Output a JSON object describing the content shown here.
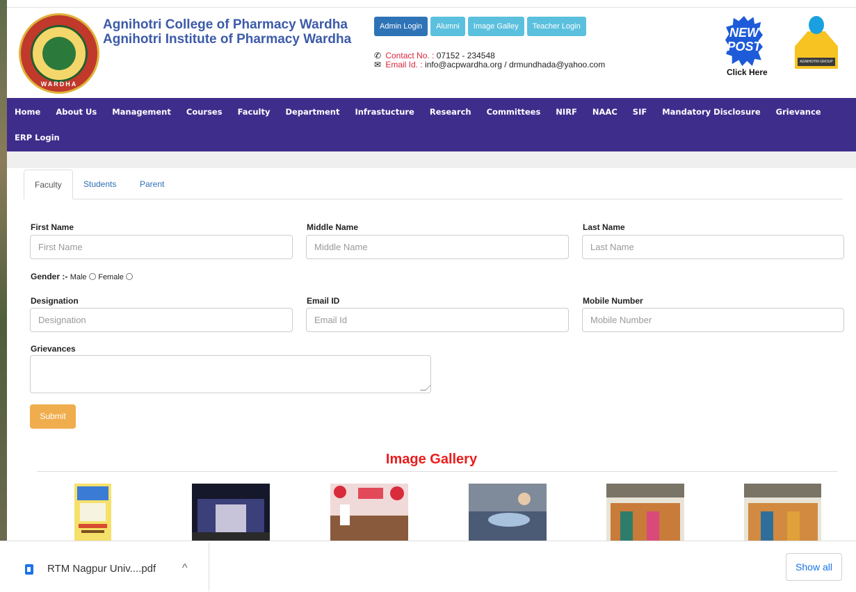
{
  "header": {
    "college_line1": "Agnihotri College of Pharmacy Wardha",
    "college_line2": "Agnihotri Institute of Pharmacy Wardha",
    "logo_text": "WARDHA",
    "top_buttons": [
      "Admin Login",
      "Alumni",
      "Image Galley",
      "Teacher Login"
    ],
    "contact_label": "Contact No. :",
    "contact_value": "07152 - 234548",
    "email_label": "Email Id. :",
    "email_value": "info@acpwardha.org / drmundhada@yahoo.com",
    "new_post_line1": "NEW",
    "new_post_line2": "POST",
    "new_post_click": "Click Here",
    "group_logo_text": "AGNIHOTRI GROUP"
  },
  "nav": {
    "row1": [
      "Home",
      "About Us",
      "Management",
      "Courses",
      "Faculty",
      "Department",
      "Infrastucture",
      "Research",
      "Committees",
      "NIRF",
      "NAAC",
      "SIF",
      "Mandatory Disclosure",
      "Grievance"
    ],
    "row2": [
      "ERP Login"
    ]
  },
  "tabs": [
    "Faculty",
    "Students",
    "Parent"
  ],
  "form": {
    "first_name_label": "First Name",
    "first_name_placeholder": "First Name",
    "middle_name_label": "Middle Name",
    "middle_name_placeholder": "Middle Name",
    "last_name_label": "Last Name",
    "last_name_placeholder": "Last Name",
    "gender_label": "Gender :-",
    "gender_male": "Male",
    "gender_female": "Female",
    "designation_label": "Designation",
    "designation_placeholder": "Designation",
    "email_label": "Email ID",
    "email_placeholder": "Email Id",
    "mobile_label": "Mobile Number",
    "mobile_placeholder": "Mobile Number",
    "grievances_label": "Grievances",
    "submit_label": "Submit"
  },
  "gallery": {
    "title": "Image Gallery"
  },
  "download_bar": {
    "file_name": "RTM Nagpur Univ....pdf",
    "show_all": "Show all"
  },
  "colors": {
    "nav_bg": "#3f2d8c",
    "college_title": "#3c5aa8",
    "gallery_title": "#ea1c1c",
    "submit_bg": "#f0ad4e",
    "primary_btn": "#2f73b7",
    "info_btn": "#5bc0de"
  }
}
